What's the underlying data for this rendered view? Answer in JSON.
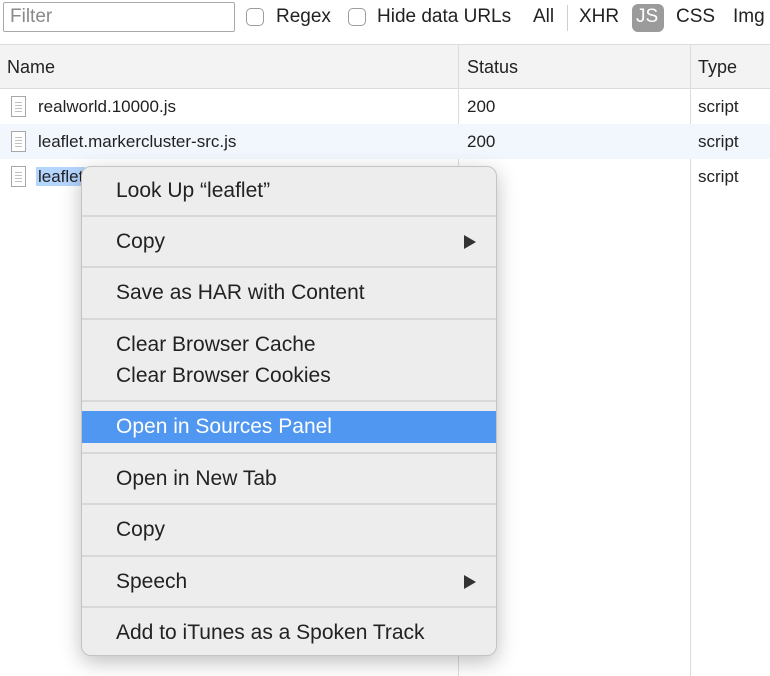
{
  "toolbar": {
    "filter_placeholder": "Filter",
    "regex_label": "Regex",
    "hide_data_urls_label": "Hide data URLs",
    "types": [
      "All",
      "XHR",
      "JS",
      "CSS",
      "Img"
    ],
    "active_type": "JS",
    "active_pill_color": "#9b9b9b"
  },
  "table": {
    "columns": [
      "Name",
      "Status",
      "Type"
    ],
    "rows": [
      {
        "name": "realworld.10000.js",
        "status": "200",
        "type": "script"
      },
      {
        "name": "leaflet.markercluster-src.js",
        "status": "200",
        "type": "script"
      },
      {
        "name": "leaflet",
        "status": "",
        "type": "script",
        "selected": true
      }
    ],
    "selected_color": "#b4d5fd",
    "alt_row_color": "#f2f7fd"
  },
  "context_menu": {
    "highlight_color": "#5097f1",
    "items": [
      {
        "label": "Look Up “leaflet”",
        "submenu": false
      },
      {
        "label": "Copy",
        "submenu": true
      },
      {
        "label": "Save as HAR with Content",
        "submenu": false
      },
      {
        "label": "Clear Browser Cache",
        "submenu": false
      },
      {
        "label": "Clear Browser Cookies",
        "submenu": false
      },
      {
        "label": "Open in Sources Panel",
        "submenu": false,
        "active": true
      },
      {
        "label": "Open in New Tab",
        "submenu": false
      },
      {
        "label": "Copy",
        "submenu": false
      },
      {
        "label": "Speech",
        "submenu": true
      },
      {
        "label": "Add to iTunes as a Spoken Track",
        "submenu": false
      }
    ]
  }
}
